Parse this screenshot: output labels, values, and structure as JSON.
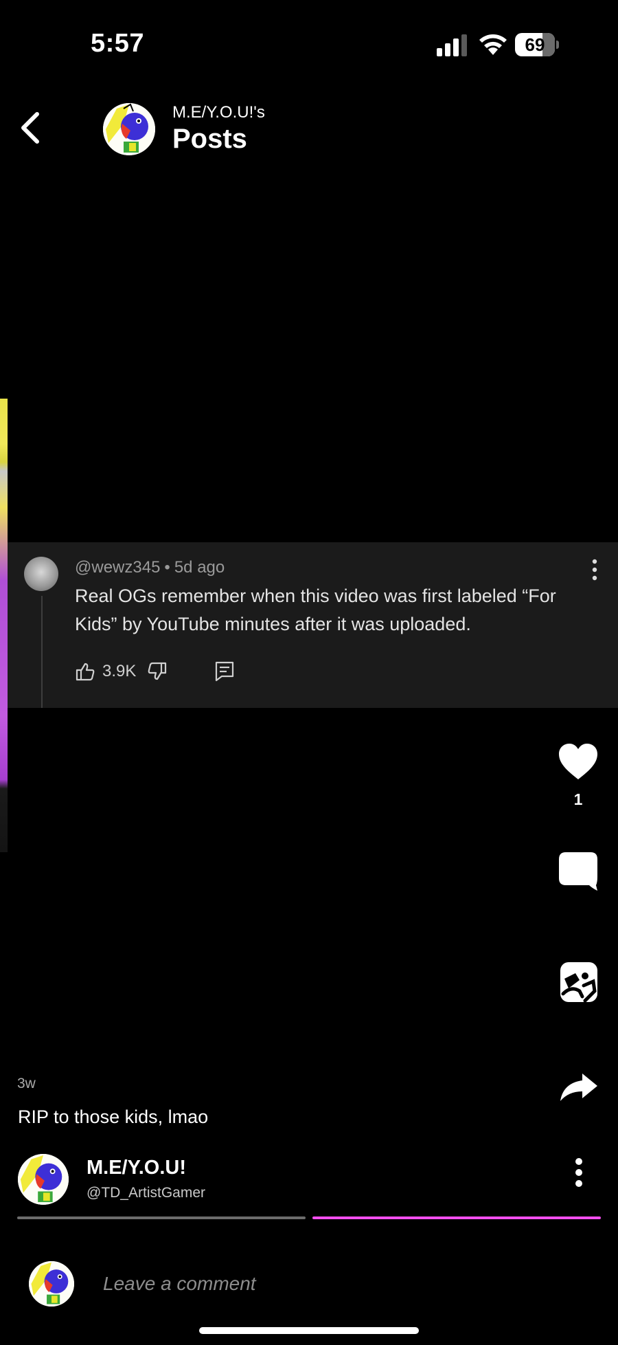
{
  "status_bar": {
    "time": "5:57",
    "battery_percent": "69",
    "battery_level": 0.69
  },
  "header": {
    "owner_label": "M.E/Y.O.U!'s",
    "title": "Posts"
  },
  "embedded_comment": {
    "username": "@wewz345",
    "separator": "•",
    "age": "5d ago",
    "text": "Real OGs remember when this video was first labeled “For Kids” by YouTube minutes after it was uploaded.",
    "like_count": "3.9K"
  },
  "actions": {
    "like_count": "1"
  },
  "post": {
    "age": "3w",
    "caption": "RIP to those kids, lmao"
  },
  "author": {
    "name": "M.E/Y.O.U!",
    "handle": "@TD_ArtistGamer"
  },
  "slides": {
    "count": 2,
    "active_index": 1
  },
  "comment_bar": {
    "placeholder": "Leave a comment"
  },
  "colors": {
    "background": "#000000",
    "accent": "#f54ef0",
    "comment_card": "#1b1b1b"
  },
  "icons": {
    "back": "chevron-left-icon",
    "like": "heart-icon",
    "comment": "speech-bubble-icon",
    "remix": "remix-icon",
    "share": "share-arrow-icon",
    "more": "more-vertical-icon"
  }
}
